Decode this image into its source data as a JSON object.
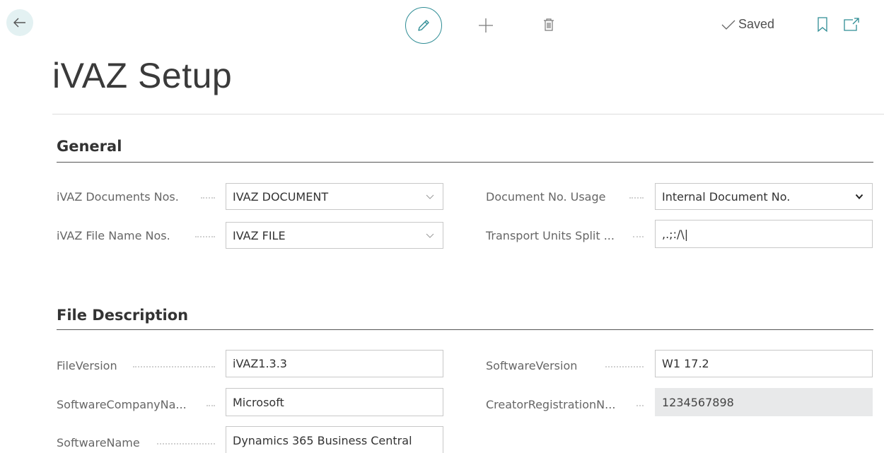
{
  "toolbar": {
    "back_icon": "arrow-left-icon",
    "edit_icon": "pencil-icon",
    "new_icon": "plus-icon",
    "delete_icon": "trash-icon",
    "saved_label": "Saved",
    "bookmark_icon": "bookmark-icon",
    "open_new_window_icon": "open-in-new-window-icon",
    "accent_color": "#2f8d95"
  },
  "page": {
    "title": "iVAZ Setup"
  },
  "sections": {
    "general": {
      "title": "General",
      "fields": {
        "documents_nos": {
          "label": "iVAZ Documents Nos.",
          "value": "IVAZ DOCUMENT"
        },
        "file_name_nos": {
          "label": "iVAZ File Name Nos.",
          "value": "IVAZ FILE"
        },
        "document_no_usage": {
          "label": "Document No. Usage",
          "value": "Internal Document No."
        },
        "transport_units_split": {
          "label": "Transport Units Split ...",
          "value": ",.;:/\\|"
        }
      }
    },
    "file_description": {
      "title": "File Description",
      "fields": {
        "file_version": {
          "label": "FileVersion",
          "value": "iVAZ1.3.3"
        },
        "software_company_name": {
          "label": "SoftwareCompanyNa...",
          "value": "Microsoft"
        },
        "software_name": {
          "label": "SoftwareName",
          "value": "Dynamics 365 Business Central"
        },
        "software_version": {
          "label": "SoftwareVersion",
          "value": "W1 17.2"
        },
        "creator_registration_no": {
          "label": "CreatorRegistrationN...",
          "value": "1234567898"
        }
      }
    }
  }
}
